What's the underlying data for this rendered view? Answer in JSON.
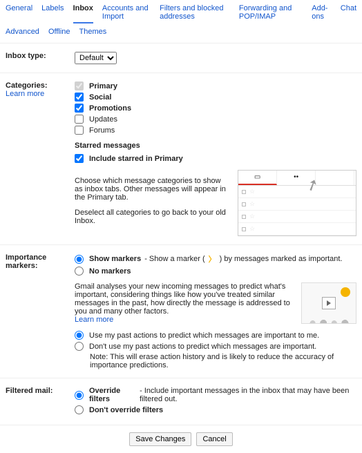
{
  "tabs": {
    "general": "General",
    "labels": "Labels",
    "inbox": "Inbox",
    "accounts": "Accounts and Import",
    "filters": "Filters and blocked addresses",
    "forwarding": "Forwarding and POP/IMAP",
    "addons": "Add-ons",
    "chat": "Chat"
  },
  "subtabs": {
    "advanced": "Advanced",
    "offline": "Offline",
    "themes": "Themes"
  },
  "inbox_type": {
    "label": "Inbox type:",
    "selected": "Default"
  },
  "categories": {
    "label": "Categories:",
    "learn": "Learn more",
    "primary": "Primary",
    "social": "Social",
    "promotions": "Promotions",
    "updates": "Updates",
    "forums": "Forums",
    "starred_h": "Starred messages",
    "include_star": "Include starred in Primary",
    "desc1": "Choose which message categories to show as inbox tabs. Other messages will appear in the Primary tab.",
    "desc2": "Deselect all categories to go back to your old Inbox."
  },
  "importance": {
    "label": "Importance markers:",
    "show": "Show markers",
    "show_desc": " - Show a marker (",
    "show_desc2": ") by messages marked as important.",
    "no": "No markers",
    "analy": "Gmail analyses your new incoming messages to predict what's important, considering things like how you've treated similar messages in the past, how directly the message is addressed to you and many other factors.",
    "learn": "Learn more",
    "use": "Use my past actions to predict which messages are important to me.",
    "dont": "Don't use my past actions to predict which messages are important.",
    "note": "Note: This will erase action history and is likely to reduce the accuracy of importance predictions."
  },
  "filtered": {
    "label": "Filtered mail:",
    "over": "Override filters",
    "over_desc": " - Include important messages in the inbox that may have been filtered out.",
    "dont": "Don't override filters"
  },
  "buttons": {
    "save": "Save Changes",
    "cancel": "Cancel"
  },
  "preview": {
    "tab1": "▢",
    "tab2": "⚇"
  }
}
